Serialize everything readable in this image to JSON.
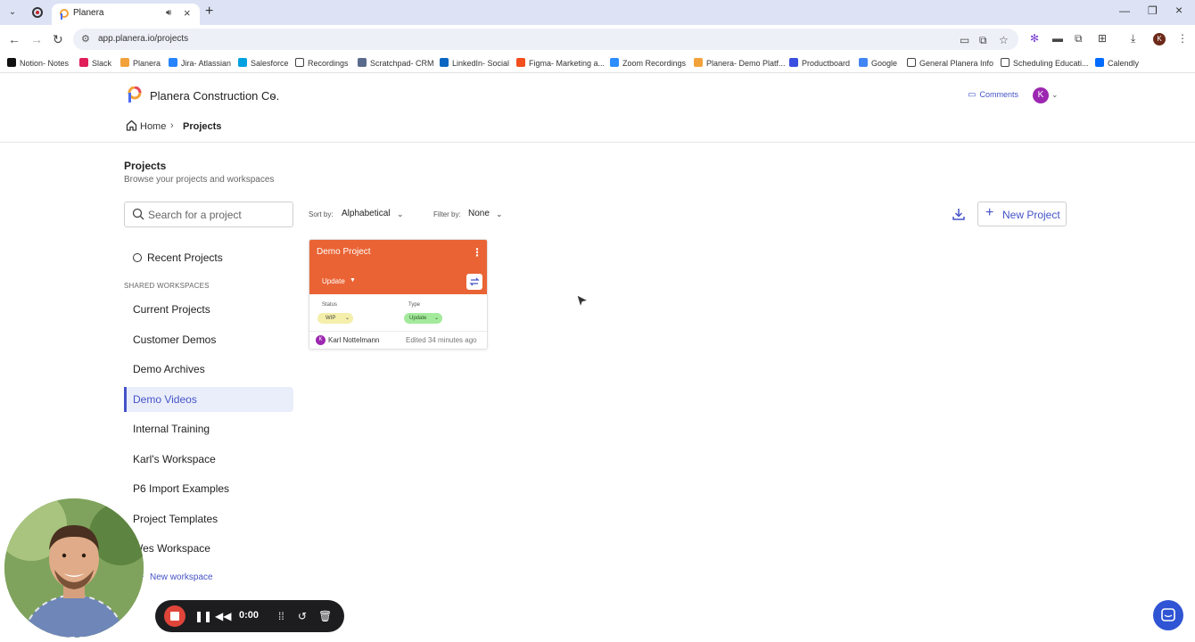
{
  "browser": {
    "tab_title": "Planera",
    "url": "app.planera.io/projects",
    "bookmarks": [
      {
        "label": "Notion- Notes",
        "color": "#111111"
      },
      {
        "label": "Slack",
        "color": "#e01e5a"
      },
      {
        "label": "Planera",
        "color": "#f2a23a"
      },
      {
        "label": "Jira- Atlassian",
        "color": "#2684ff"
      },
      {
        "label": "Salesforce",
        "color": "#00a1e0"
      },
      {
        "label": "Recordings",
        "color": "folder"
      },
      {
        "label": "Scratchpad- CRM",
        "color": "#5b6b8c"
      },
      {
        "label": "LinkedIn- Social",
        "color": "#0a66c2"
      },
      {
        "label": "Figma- Marketing a...",
        "color": "#f24e1e"
      },
      {
        "label": "Zoom Recordings",
        "color": "#2d8cff"
      },
      {
        "label": "Planera- Demo Platf...",
        "color": "#f2a23a"
      },
      {
        "label": "Productboard",
        "color": "#3a4ee0"
      },
      {
        "label": "Google",
        "color": "#4285f4"
      },
      {
        "label": "General Planera Info",
        "color": "folder"
      },
      {
        "label": "Scheduling Educati...",
        "color": "folder"
      },
      {
        "label": "Calendly",
        "color": "#006bff"
      }
    ],
    "profile_initial": "K"
  },
  "header": {
    "company": "Planera Construction Co.",
    "comments": "Comments",
    "avatar_initial": "K",
    "breadcrumb": {
      "home": "Home",
      "current": "Projects"
    }
  },
  "page": {
    "title": "Projects",
    "subtitle": "Browse your projects and workspaces",
    "search_placeholder": "Search for a project",
    "sort_label": "Sort by:",
    "sort_value": "Alphabetical",
    "filter_label": "Filter by:",
    "filter_value": "None",
    "new_project": "New Project"
  },
  "sidebar": {
    "recent": "Recent Projects",
    "shared_label": "SHARED WORKSPACES",
    "workspaces": [
      {
        "label": "Current Projects",
        "active": false
      },
      {
        "label": "Customer Demos",
        "active": false
      },
      {
        "label": "Demo Archives",
        "active": false
      },
      {
        "label": "Demo Videos",
        "active": true
      },
      {
        "label": "Internal Training",
        "active": false
      },
      {
        "label": "Karl's Workspace",
        "active": false
      },
      {
        "label": "P6 Import Examples",
        "active": false
      },
      {
        "label": "Project Templates",
        "active": false
      },
      {
        "label": "Wes Workspace",
        "active": false
      }
    ],
    "new_workspace": "New workspace"
  },
  "card": {
    "title": "Demo Project",
    "update_label": "Update",
    "status_label": "Status",
    "status_value": "WIP",
    "type_label": "Type",
    "type_value": "Update",
    "owner_initial": "K",
    "owner": "Karl Nottelmann",
    "edited": "Edited 34 minutes ago",
    "accent_color": "#ea6334"
  },
  "recorder": {
    "time": "0:00"
  },
  "colors": {
    "primary": "#4453c7",
    "card_accent": "#ea6334",
    "wip_pill": "#f4efaa",
    "type_pill": "#a4ea9c",
    "chat_bubble": "#2f54d4"
  }
}
